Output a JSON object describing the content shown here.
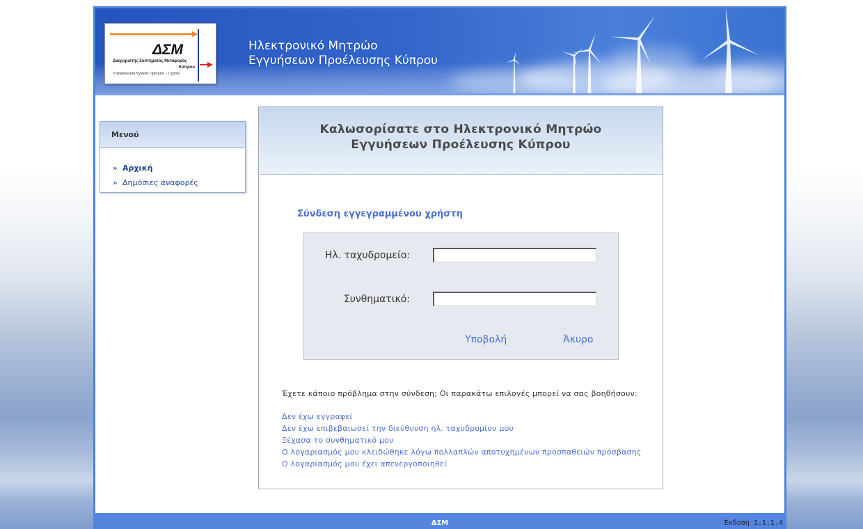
{
  "header": {
    "title_line1": "Ηλεκτρονικό Μητρώο",
    "title_line2": "Εγγυήσεων Προέλευσης Κύπρου"
  },
  "logo": {
    "mark": "ΔΣΜ",
    "line1": "Διαχειριστής Συστήματος Μεταφοράς",
    "line2": "Κύπρου",
    "line3": "Transmission System Operator - Cyprus"
  },
  "sidebar": {
    "title": "Μενού",
    "items": [
      {
        "label": "Αρχική",
        "active": true
      },
      {
        "label": "Δημόσιες αναφορές",
        "active": false
      }
    ]
  },
  "welcome": {
    "line1": "Καλωσορίσατε στο Ηλεκτρονικό Μητρώο",
    "line2": "Εγγυήσεων Προέλευσης Κύπρου"
  },
  "login": {
    "heading": "Σύνδεση εγγεγραμμένου χρήστη",
    "email_label": "Ηλ. ταχυδρομείο:",
    "email_value": "",
    "password_label": "Συνθηματικό:",
    "password_value": "",
    "submit_label": "Υποβολή",
    "cancel_label": "Άκυρο"
  },
  "help": {
    "intro": "Έχετε κάποιο πρόβλημα στην σύνδεση; Οι παρακάτω επιλογές μπορεί να σας βοηθήσουν:",
    "links": [
      "Δεν έχω εγγραφεί",
      "Δεν έχω επιβεβαιωσεί την διεύθυνση ηλ. ταχυδρομίου μου",
      "Ξέχασα το συνθηματικό μου",
      "Ο λογαριασμός μου κλειδώθηκε λόγω πολλαπλών αποτυχημένων προσπαθειών πρόσβασης",
      "Ο λογαριασμός μου έχει απενεργοποιηθεί"
    ]
  },
  "footer": {
    "center": "ΔΣΜ",
    "version": "Έκδοση 1.1.1.4"
  },
  "icons": {
    "menu_bullet": "double-chevron-right-icon",
    "menu_bullet_glyph": "»",
    "header_art": "wind-turbines-illustration",
    "logo_arrows": "logo-arrows-icon"
  },
  "colors": {
    "brand": "#4f82d8",
    "footer": "#5585de",
    "link": "#4a6fd2",
    "menu-link": "#1d4494",
    "logo-orange": "#f07d1e",
    "logo-red": "#d9262c",
    "logo-navy": "#1e3f8f"
  }
}
